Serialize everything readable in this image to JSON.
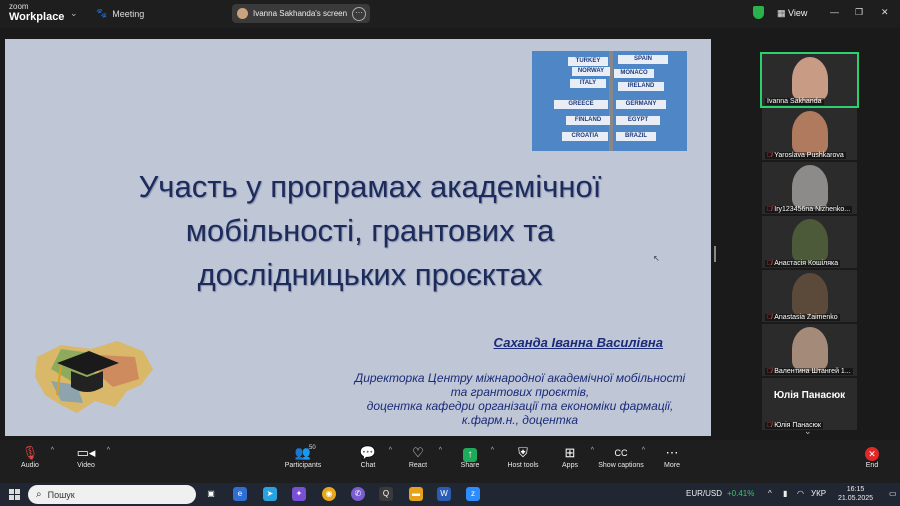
{
  "app": {
    "brand_top": "zoom",
    "brand_bottom": "Workplace",
    "meeting_label": "Meeting",
    "share_label": "Ivanna Sakhanda's screen",
    "view_label": "View"
  },
  "slide": {
    "title_line1": "Участь у програмах академічної",
    "title_line2": "мобільності, грантових та",
    "title_line3": "дослідницьких проєктах",
    "author": "Саханда Іванна Василівна",
    "role_line1": "Директорка Центру міжнародної академічної мобільності",
    "role_line2": "та грантових проєктів,",
    "role_line3": "доцентка кафедри організації та економіки фармації,",
    "role_line4": "к.фарм.н., доцентка",
    "signs": [
      "SPAIN",
      "TURKEY",
      "NORWAY",
      "MONACO",
      "ITALY",
      "IRELAND",
      "GREECE",
      "GERMANY",
      "FINLAND",
      "EGYPT",
      "CROATIA",
      "BRAZIL"
    ]
  },
  "participants": [
    {
      "name": "Ivanna Sakhanda",
      "muted": false,
      "color": "#c79b84"
    },
    {
      "name": "Yaroslava Pushkarova",
      "muted": true,
      "color": "#b07a5f"
    },
    {
      "name": "Iry123456na Nizhenko...",
      "muted": true,
      "color": "#8d8a8a"
    },
    {
      "name": "Анастасія Кошіляка",
      "muted": true,
      "color": "#4d5a3a"
    },
    {
      "name": "Anastasia Zaimenko",
      "muted": true,
      "color": "#5b4a3a"
    },
    {
      "name": "Валентина Штангей 1...",
      "muted": true,
      "color": "#a48b79"
    }
  ],
  "featured_name": "Юлія Панасюк",
  "last_participant": "Юлія Панасюк",
  "toolbar": {
    "audio": "Audio",
    "video": "Video",
    "participants": "Participants",
    "participants_count": "50",
    "chat": "Chat",
    "react": "React",
    "share": "Share",
    "host_tools": "Host tools",
    "apps": "Apps",
    "captions": "Show captions",
    "captions_icon": "CC",
    "more": "More",
    "end": "End"
  },
  "taskbar": {
    "search_placeholder": "Пошук",
    "currency": "EUR/USD",
    "currency_change": "+0.41%",
    "lang": "УКР",
    "time": "16:15",
    "date": "21.05.2025"
  },
  "colors": {
    "slide_bg": "#bfc6d6",
    "title": "#1c2b5c",
    "accent_green": "#2ed06e",
    "share_green": "#1faa59",
    "end_red": "#e02828"
  }
}
